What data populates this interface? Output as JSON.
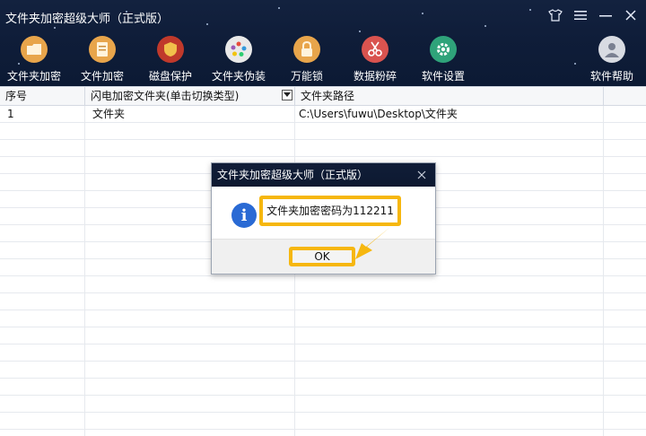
{
  "app": {
    "title": "文件夹加密超级大师（正式版）"
  },
  "toolbar": {
    "items": [
      {
        "label": "文件夹加密",
        "icon": "folder-lock-icon",
        "color": "#e8a54b"
      },
      {
        "label": "文件加密",
        "icon": "file-lock-icon",
        "color": "#e8a54b"
      },
      {
        "label": "磁盘保护",
        "icon": "shield-icon",
        "color": "#c0392b"
      },
      {
        "label": "文件夹伪装",
        "icon": "palette-icon",
        "color": "#e0e0e0"
      },
      {
        "label": "万能锁",
        "icon": "padlock-icon",
        "color": "#e8a54b"
      },
      {
        "label": "数据粉碎",
        "icon": "scissors-icon",
        "color": "#d9534f"
      },
      {
        "label": "软件设置",
        "icon": "gear-icon",
        "color": "#2fa37a"
      }
    ],
    "help_label": "软件帮助"
  },
  "table": {
    "headers": [
      "序号",
      "闪电加密文件夹(单击切换类型)",
      "文件夹路径"
    ],
    "rows": [
      [
        "1",
        "文件夹",
        "C:\\Users\\fuwu\\Desktop\\文件夹"
      ]
    ]
  },
  "dialog": {
    "title": "文件夹加密超级大师（正式版）",
    "message": "文件夹加密密码为112211",
    "ok_label": "OK"
  },
  "colors": {
    "accent": "#f6b70f",
    "header_bg": "#0f1d39",
    "info_blue": "#2a6ad4"
  }
}
